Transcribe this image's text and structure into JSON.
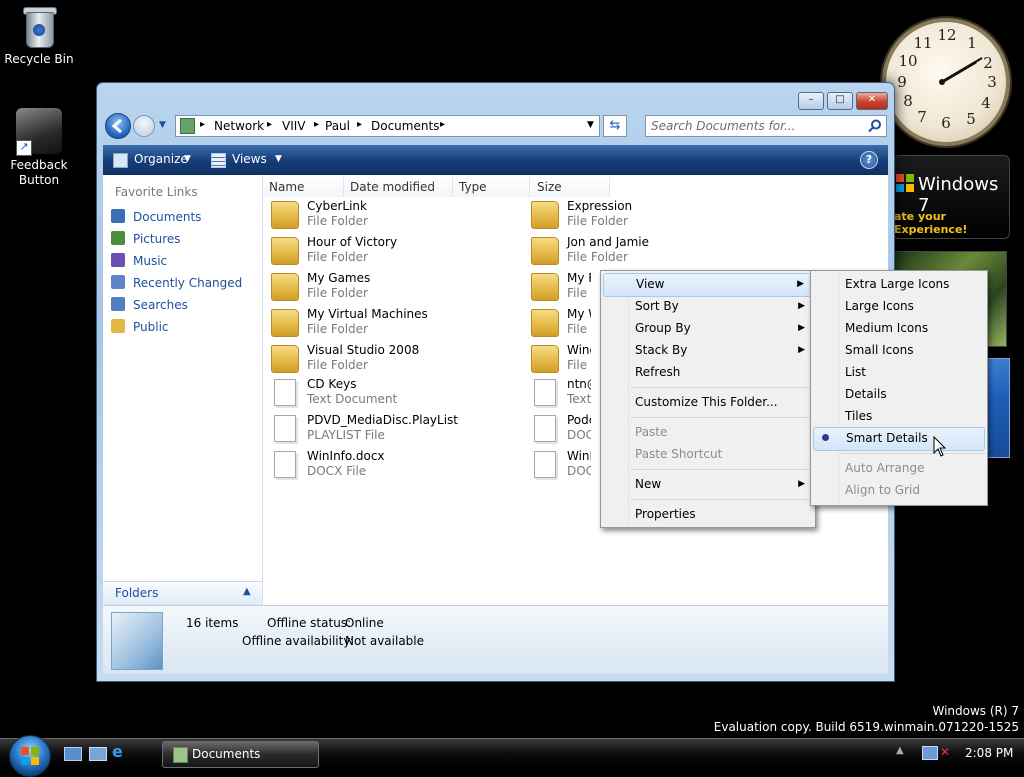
{
  "desktop": {
    "icons": [
      {
        "label": "Recycle Bin",
        "icon": "recycle-bin-icon"
      },
      {
        "label": "Feedback Button",
        "icon": "feedback-icon"
      }
    ],
    "clock_numbers": [
      "12",
      "1",
      "2",
      "3",
      "4",
      "5",
      "6",
      "7",
      "8",
      "9",
      "10",
      "11"
    ],
    "gadget_banner": {
      "title": "Windows 7",
      "subtitle": "ate your Experience!"
    },
    "watermark": {
      "line1": "Windows (R) 7",
      "line2": "Evaluation copy. Build 6519.winmain.071220-1525"
    }
  },
  "window": {
    "title_buttons": {
      "minimize": "–",
      "maximize": "□",
      "close": "✕"
    },
    "breadcrumbs": [
      "Network",
      "VIIV",
      "Paul",
      "Documents"
    ],
    "search_placeholder": "Search Documents for...",
    "toolbar": {
      "organize": "Organize",
      "views": "Views",
      "help": "?"
    }
  },
  "sidebar": {
    "header": "Favorite Links",
    "links": [
      {
        "label": "Documents",
        "color": "#3b6fb6"
      },
      {
        "label": "Pictures",
        "color": "#4b8f3c"
      },
      {
        "label": "Music",
        "color": "#6c4fb0"
      },
      {
        "label": "Recently Changed",
        "color": "#5e86c4"
      },
      {
        "label": "Searches",
        "color": "#4e7fc0"
      },
      {
        "label": "Public",
        "color": "#e3b744"
      }
    ],
    "folders_label": "Folders"
  },
  "columns": [
    "Name",
    "Date modified",
    "Type",
    "Size"
  ],
  "files": [
    {
      "name": "CyberLink",
      "type": "File Folder",
      "kind": "folder"
    },
    {
      "name": "Hour of Victory",
      "type": "File Folder",
      "kind": "folder"
    },
    {
      "name": "My Games",
      "type": "File Folder",
      "kind": "folder"
    },
    {
      "name": "My Virtual Machines",
      "type": "File Folder",
      "kind": "folder"
    },
    {
      "name": "Visual Studio 2008",
      "type": "File Folder",
      "kind": "folder"
    },
    {
      "name": "CD Keys",
      "type": "Text Document",
      "kind": "doc"
    },
    {
      "name": "PDVD_MediaDisc.PlayList",
      "type": "PLAYLIST File",
      "kind": "doc"
    },
    {
      "name": "WinInfo.docx",
      "type": "DOCX File",
      "kind": "doc"
    },
    {
      "name": "Expression",
      "type": "File Folder",
      "kind": "folder"
    },
    {
      "name": "Jon and Jamie",
      "type": "File Folder",
      "kind": "folder"
    },
    {
      "name": "My Re",
      "type": "File Fo",
      "kind": "folder"
    },
    {
      "name": "My We",
      "type": "File Fo",
      "kind": "folder"
    },
    {
      "name": "Windo",
      "type": "File Fo",
      "kind": "folder"
    },
    {
      "name": "ntn@p",
      "type": "Text D",
      "kind": "doc"
    },
    {
      "name": "Podca",
      "type": "DOCX",
      "kind": "doc"
    },
    {
      "name": "WinInf",
      "type": "DOCX",
      "kind": "doc"
    }
  ],
  "details": {
    "count": "16 items",
    "offline_status_label": "Offline status:",
    "offline_status_value": "Online",
    "offline_avail_label": "Offline availability:",
    "offline_avail_value": "Not available"
  },
  "context_menu": {
    "items": [
      {
        "label": "View",
        "submenu": true,
        "highlight": true
      },
      {
        "label": "Sort By",
        "submenu": true
      },
      {
        "label": "Group By",
        "submenu": true
      },
      {
        "label": "Stack By",
        "submenu": true
      },
      {
        "label": "Refresh"
      },
      {
        "label": "Customize This Folder..."
      },
      {
        "label": "Paste",
        "disabled": true
      },
      {
        "label": "Paste Shortcut",
        "disabled": true
      },
      {
        "label": "New",
        "submenu": true
      },
      {
        "label": "Properties"
      }
    ]
  },
  "view_submenu": {
    "items": [
      {
        "label": "Extra Large Icons"
      },
      {
        "label": "Large Icons"
      },
      {
        "label": "Medium Icons"
      },
      {
        "label": "Small Icons"
      },
      {
        "label": "List"
      },
      {
        "label": "Details"
      },
      {
        "label": "Tiles"
      },
      {
        "label": "Smart Details",
        "selected": true
      },
      {
        "label": "Auto Arrange",
        "disabled": true
      },
      {
        "label": "Align to Grid",
        "disabled": true
      }
    ]
  },
  "taskbar": {
    "task_label": "Documents",
    "time": "2:08 PM"
  }
}
